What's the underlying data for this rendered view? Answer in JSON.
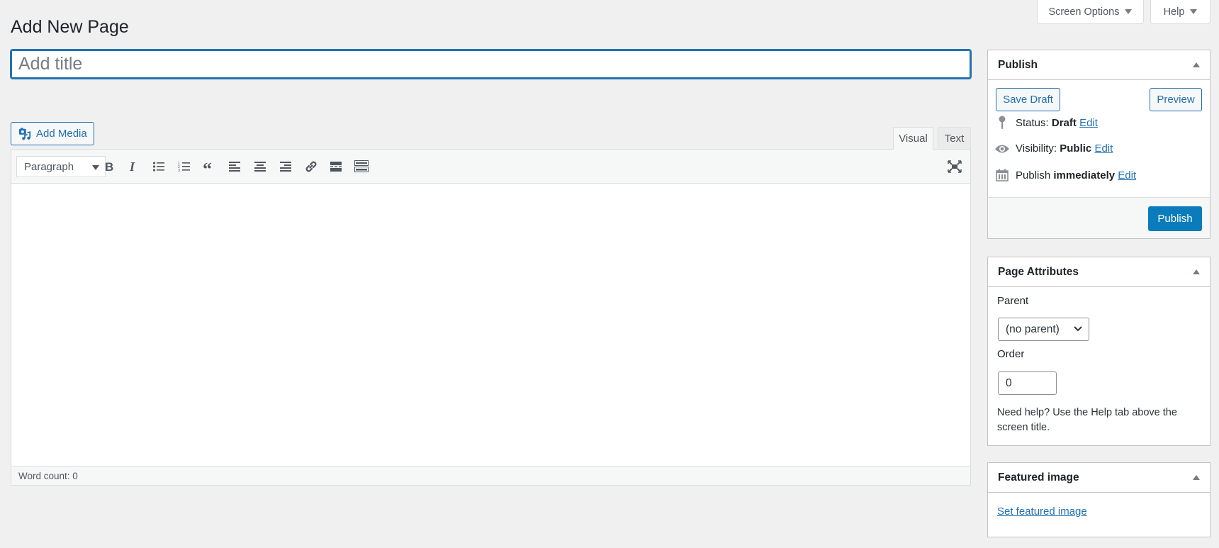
{
  "screen_meta": {
    "screen_options_label": "Screen Options",
    "help_label": "Help"
  },
  "page": {
    "title": "Add New Page"
  },
  "title_field": {
    "value": "",
    "placeholder": "Add title"
  },
  "editor": {
    "add_media_label": "Add Media",
    "tabs": [
      {
        "label": "Visual",
        "active": true
      },
      {
        "label": "Text",
        "active": false
      }
    ],
    "format_select": "Paragraph",
    "toolbar_icons": [
      "bold-icon",
      "italic-icon",
      "bulleted-list-icon",
      "numbered-list-icon",
      "blockquote-icon",
      "align-left-icon",
      "align-center-icon",
      "align-right-icon",
      "link-icon",
      "read-more-icon",
      "toolbar-toggle-icon",
      "fullscreen-icon"
    ],
    "content": "",
    "word_count_label": "Word count: 0"
  },
  "publish_box": {
    "title": "Publish",
    "save_draft_label": "Save Draft",
    "preview_label": "Preview",
    "status_label": "Status:",
    "status_value": "Draft",
    "visibility_label": "Visibility:",
    "visibility_value": "Public",
    "schedule_label": "Publish",
    "schedule_value": "immediately",
    "edit_label": "Edit",
    "publish_label": "Publish",
    "primary_color": "#0a7cbc"
  },
  "attributes_box": {
    "title": "Page Attributes",
    "parent_label": "Parent",
    "parent_value": "(no parent)",
    "order_label": "Order",
    "order_value": "0",
    "help_text": "Need help? Use the Help tab above the screen title."
  },
  "featured_box": {
    "title": "Featured image",
    "link_label": "Set featured image"
  }
}
